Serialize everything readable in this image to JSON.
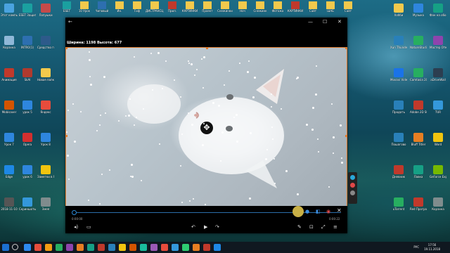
{
  "window": {
    "back_label": "←",
    "dimensions_text": "Ширина: 1198 Высота: 677",
    "minimize": "—",
    "maximize": "☐",
    "close": "✕"
  },
  "player": {
    "time_current": "0:00:00",
    "time_total": "0:00:22",
    "progress": 0.0,
    "move_icon": "✥",
    "close_icon": "✕"
  },
  "desktop_left": [
    {
      "label": "Этот компьютер",
      "color": "#4aa3df"
    },
    {
      "label": "ESET Защита банковск...",
      "color": "#1aa0a0"
    },
    {
      "label": "Лопушки",
      "color": "#c44a4a"
    },
    {
      "label": "Корзина",
      "color": "#8fb8d8"
    },
    {
      "label": "INTRO(1)",
      "color": "#2d6fb0"
    },
    {
      "label": "Средство просмот...",
      "color": "#2d5a8a"
    },
    {
      "label": "Анимация",
      "color": "#c0392b"
    },
    {
      "label": "SkAI",
      "color": "#b03a2e"
    },
    {
      "label": "Новая папка",
      "color": "#f2c94c"
    },
    {
      "label": "Mobisaver",
      "color": "#d35400"
    },
    {
      "label": "урок 5",
      "color": "#2e86de"
    },
    {
      "label": "Яндекс",
      "color": "#e74c3c"
    },
    {
      "label": "Урок 7",
      "color": "#2e86de"
    },
    {
      "label": "Opera",
      "color": "#d32f2f"
    },
    {
      "label": "Урок 8",
      "color": "#2e86de"
    },
    {
      "label": "Edge",
      "color": "#1e88e5"
    },
    {
      "label": "урок 6",
      "color": "#2e86de"
    },
    {
      "label": "Заметки в Яндекс.Д...",
      "color": "#f1c40f"
    },
    {
      "label": "2018-11-10",
      "color": "#555555"
    },
    {
      "label": "Скриншоты в Яндекс...",
      "color": "#3498db"
    },
    {
      "label": "Змея",
      "color": "#7f8c8d"
    }
  ],
  "desktop_top": [
    {
      "label": "ESET",
      "color": "#1aa0a0"
    },
    {
      "label": "10 Урок",
      "color": "#f2c94c"
    },
    {
      "label": "Чиповый",
      "color": "#2d6fb0"
    },
    {
      "label": "Ин.",
      "color": "#f2c94c"
    },
    {
      "label": "Гиф",
      "color": "#f2c94c"
    },
    {
      "label": "ДИСТРАНСЦ...",
      "color": "#f2c94c"
    },
    {
      "label": "Прил.",
      "color": "#c0392b"
    },
    {
      "label": "КАРТИНКИ",
      "color": "#f2c94c"
    },
    {
      "label": "Проект",
      "color": "#f2c94c"
    },
    {
      "label": "Снежинки",
      "color": "#f2c94c"
    },
    {
      "label": "Ноч",
      "color": "#f2c94c"
    },
    {
      "label": "Снежинк",
      "color": "#f2c94c"
    },
    {
      "label": "Фотожа",
      "color": "#f2c94c"
    },
    {
      "label": "КАРТИНКИ",
      "color": "#c0392b"
    },
    {
      "label": "Сайт",
      "color": "#f2c94c"
    },
    {
      "label": "ШАБ",
      "color": "#f2c94c"
    },
    {
      "label": "Сайт",
      "color": "#f2c94c"
    }
  ],
  "desktop_right": [
    {
      "label": "Хобби",
      "color": "#f2c94c"
    },
    {
      "label": "Музыка",
      "color": "#2e86de"
    },
    {
      "label": "Фон на обоях",
      "color": "#16a085"
    },
    {
      "label": "Xun Thunder",
      "color": "#2980b9"
    },
    {
      "label": "NatureStudio",
      "color": "#27ae60"
    },
    {
      "label": "Мастер Открытки",
      "color": "#8e44ad"
    },
    {
      "label": "Movavi Video Suite",
      "color": "#1a73e8"
    },
    {
      "label": "Camtasia 2018",
      "color": "#27ae60"
    },
    {
      "label": "aDriveWall",
      "color": "#2c3e50"
    },
    {
      "label": "Продать",
      "color": "#2980b9"
    },
    {
      "label": "Adobe 2D Stamp",
      "color": "#c0392b"
    },
    {
      "label": "TUR",
      "color": "#3498db"
    },
    {
      "label": "Пошагово",
      "color": "#2980b9"
    },
    {
      "label": "Bluff Titler",
      "color": "#e67e22"
    },
    {
      "label": "Word",
      "color": "#f1c40f"
    },
    {
      "label": "Дневник",
      "color": "#c0392b"
    },
    {
      "label": "Лавка",
      "color": "#16a085"
    },
    {
      "label": "GeForce Experience",
      "color": "#76b900"
    },
    {
      "label": "uTorrent",
      "color": "#27ae60"
    },
    {
      "label": "Red Программ",
      "color": "#c0392b"
    },
    {
      "label": "Корзина",
      "color": "#7f8c8d"
    }
  ],
  "taskbar": {
    "lang": "РУС",
    "time": "17:56",
    "date": "19.11.2018",
    "apps": [
      "#2d89ef",
      "#e74c3c",
      "#f39c12",
      "#27ae60",
      "#8e44ad",
      "#e67e22",
      "#16a085",
      "#c0392b",
      "#2980b9",
      "#f1c40f",
      "#d35400",
      "#1abc9c",
      "#9b59b6",
      "#e74c3c",
      "#3498db",
      "#2ecc71",
      "#e67e22",
      "#c0392b",
      "#1e88e5"
    ]
  }
}
